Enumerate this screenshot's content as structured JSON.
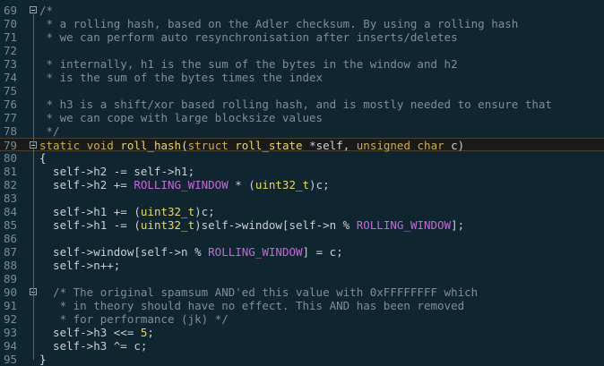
{
  "editor": {
    "lines": [
      {
        "n": "69",
        "fold": true,
        "tokens": [
          {
            "t": "/*",
            "c": "cm"
          }
        ]
      },
      {
        "n": "70",
        "tokens": [
          {
            "t": " * a rolling hash, based on the Adler checksum. By using a rolling hash",
            "c": "cm"
          }
        ]
      },
      {
        "n": "71",
        "tokens": [
          {
            "t": " * we can perform auto resynchronisation after inserts/deletes",
            "c": "cm"
          }
        ]
      },
      {
        "n": "72",
        "tokens": [
          {
            "t": "",
            "c": "cm"
          }
        ]
      },
      {
        "n": "73",
        "tokens": [
          {
            "t": " * internally, h1 is the sum of the bytes in the window and h2",
            "c": "cm"
          }
        ]
      },
      {
        "n": "74",
        "tokens": [
          {
            "t": " * is the sum of the bytes times the index",
            "c": "cm"
          }
        ]
      },
      {
        "n": "75",
        "tokens": [
          {
            "t": "",
            "c": "cm"
          }
        ]
      },
      {
        "n": "76",
        "tokens": [
          {
            "t": " * h3 is a shift/xor based rolling hash, and is mostly needed to ensure that",
            "c": "cm"
          }
        ]
      },
      {
        "n": "77",
        "tokens": [
          {
            "t": " * we can cope with large blocksize values",
            "c": "cm"
          }
        ]
      },
      {
        "n": "78",
        "tokens": [
          {
            "t": " */",
            "c": "cm"
          }
        ]
      },
      {
        "n": "79",
        "fold": true,
        "current": true,
        "tokens": [
          {
            "t": "static",
            "c": "kw"
          },
          {
            "t": " ",
            "c": "id"
          },
          {
            "t": "void",
            "c": "kw"
          },
          {
            "t": " ",
            "c": "id"
          },
          {
            "t": "roll_hash",
            "c": "fn"
          },
          {
            "t": "(",
            "c": "pu"
          },
          {
            "t": "struct",
            "c": "kw"
          },
          {
            "t": " ",
            "c": "id"
          },
          {
            "t": "roll_state",
            "c": "ty"
          },
          {
            "t": " *self, ",
            "c": "id"
          },
          {
            "t": "unsigned",
            "c": "kw"
          },
          {
            "t": " ",
            "c": "id"
          },
          {
            "t": "char",
            "c": "kw"
          },
          {
            "t": " c)",
            "c": "id"
          }
        ]
      },
      {
        "n": "80",
        "tokens": [
          {
            "t": "{",
            "c": "pu"
          }
        ]
      },
      {
        "n": "81",
        "tokens": [
          {
            "t": "  self->h2 -= self->h1;",
            "c": "id"
          }
        ]
      },
      {
        "n": "82",
        "tokens": [
          {
            "t": "  self->h2 += ",
            "c": "id"
          },
          {
            "t": "ROLLING_WINDOW",
            "c": "mac"
          },
          {
            "t": " * (",
            "c": "id"
          },
          {
            "t": "uint32_t",
            "c": "ty"
          },
          {
            "t": ")c;",
            "c": "id"
          }
        ]
      },
      {
        "n": "83",
        "tokens": [
          {
            "t": "",
            "c": "id"
          }
        ]
      },
      {
        "n": "84",
        "tokens": [
          {
            "t": "  self->h1 += (",
            "c": "id"
          },
          {
            "t": "uint32_t",
            "c": "ty"
          },
          {
            "t": ")c;",
            "c": "id"
          }
        ]
      },
      {
        "n": "85",
        "tokens": [
          {
            "t": "  self->h1 -= (",
            "c": "id"
          },
          {
            "t": "uint32_t",
            "c": "ty"
          },
          {
            "t": ")self->window[self->n % ",
            "c": "id"
          },
          {
            "t": "ROLLING_WINDOW",
            "c": "mac"
          },
          {
            "t": "];",
            "c": "id"
          }
        ]
      },
      {
        "n": "86",
        "tokens": [
          {
            "t": "",
            "c": "id"
          }
        ]
      },
      {
        "n": "87",
        "tokens": [
          {
            "t": "  self->window[self->n % ",
            "c": "id"
          },
          {
            "t": "ROLLING_WINDOW",
            "c": "mac"
          },
          {
            "t": "] = c;",
            "c": "id"
          }
        ]
      },
      {
        "n": "88",
        "tokens": [
          {
            "t": "  self->n++;",
            "c": "id"
          }
        ]
      },
      {
        "n": "89",
        "tokens": [
          {
            "t": "",
            "c": "id"
          }
        ]
      },
      {
        "n": "90",
        "fold": true,
        "tokens": [
          {
            "t": "  /* The original spamsum AND'ed this value with 0xFFFFFFFF which",
            "c": "cm"
          }
        ]
      },
      {
        "n": "91",
        "tokens": [
          {
            "t": "   * in theory should have no effect. This AND has been removed",
            "c": "cm"
          }
        ]
      },
      {
        "n": "92",
        "tokens": [
          {
            "t": "   * for performance (jk) */",
            "c": "cm"
          }
        ]
      },
      {
        "n": "93",
        "tokens": [
          {
            "t": "  self->h3 <<= ",
            "c": "id"
          },
          {
            "t": "5",
            "c": "num"
          },
          {
            "t": ";",
            "c": "id"
          }
        ]
      },
      {
        "n": "94",
        "tokens": [
          {
            "t": "  self->h3 ^= c;",
            "c": "id"
          }
        ]
      },
      {
        "n": "95",
        "tokens": [
          {
            "t": "}",
            "c": "pu"
          }
        ]
      }
    ]
  }
}
